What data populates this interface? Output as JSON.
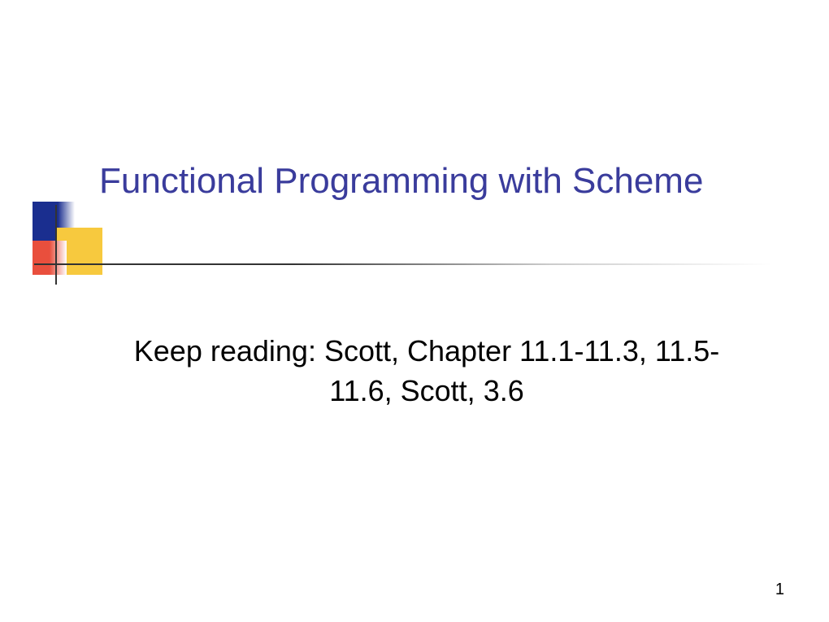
{
  "slide": {
    "title": "Functional Programming with Scheme",
    "body": "Keep reading: Scott, Chapter 11.1-11.3, 11.5-11.6, Scott, 3.6",
    "pageNumber": "1"
  }
}
